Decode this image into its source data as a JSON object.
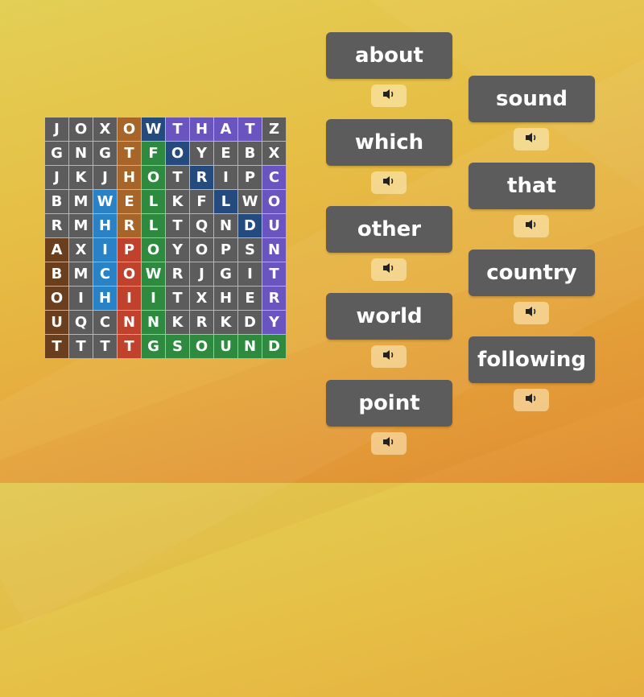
{
  "colors": {
    "cell_default": "#5c5c5c",
    "word_button": "#5c5c5c",
    "highlight": {
      "other": "#a8652a",
      "world": "#254a7d",
      "that": "#6a54c0",
      "following": "#2e8a3e",
      "country": "#6a54c0",
      "which": "#2a82c6",
      "about": "#6b3e1e",
      "point": "#c0412c",
      "sound": "#2e8a3e"
    }
  },
  "grid": {
    "rows": [
      [
        "J",
        "O",
        "X",
        "O",
        "W",
        "T",
        "H",
        "A",
        "T",
        "Z"
      ],
      [
        "G",
        "N",
        "G",
        "T",
        "F",
        "O",
        "Y",
        "E",
        "B",
        "X"
      ],
      [
        "J",
        "K",
        "J",
        "H",
        "O",
        "T",
        "R",
        "I",
        "P",
        "C"
      ],
      [
        "B",
        "M",
        "W",
        "E",
        "L",
        "K",
        "F",
        "L",
        "W",
        "O"
      ],
      [
        "R",
        "M",
        "H",
        "R",
        "L",
        "T",
        "Q",
        "N",
        "D",
        "U"
      ],
      [
        "A",
        "X",
        "I",
        "P",
        "O",
        "Y",
        "O",
        "P",
        "S",
        "N"
      ],
      [
        "B",
        "M",
        "C",
        "O",
        "W",
        "R",
        "J",
        "G",
        "I",
        "T"
      ],
      [
        "O",
        "I",
        "H",
        "I",
        "I",
        "T",
        "X",
        "H",
        "E",
        "R"
      ],
      [
        "U",
        "Q",
        "C",
        "N",
        "N",
        "K",
        "R",
        "K",
        "D",
        "Y"
      ],
      [
        "T",
        "T",
        "T",
        "T",
        "G",
        "S",
        "O",
        "U",
        "N",
        "D"
      ]
    ],
    "found_words": [
      {
        "word": "other",
        "cells": [
          [
            0,
            3
          ],
          [
            1,
            3
          ],
          [
            2,
            3
          ],
          [
            3,
            3
          ],
          [
            4,
            3
          ]
        ]
      },
      {
        "word": "world",
        "cells": [
          [
            0,
            4
          ],
          [
            1,
            5
          ],
          [
            2,
            6
          ],
          [
            3,
            7
          ],
          [
            4,
            8
          ]
        ]
      },
      {
        "word": "that",
        "cells": [
          [
            0,
            5
          ],
          [
            0,
            6
          ],
          [
            0,
            7
          ],
          [
            0,
            8
          ]
        ]
      },
      {
        "word": "following",
        "cells": [
          [
            1,
            4
          ],
          [
            2,
            4
          ],
          [
            3,
            4
          ],
          [
            4,
            4
          ],
          [
            5,
            4
          ],
          [
            6,
            4
          ],
          [
            7,
            4
          ],
          [
            8,
            4
          ],
          [
            9,
            4
          ]
        ]
      },
      {
        "word": "country",
        "cells": [
          [
            2,
            9
          ],
          [
            3,
            9
          ],
          [
            4,
            9
          ],
          [
            5,
            9
          ],
          [
            6,
            9
          ],
          [
            7,
            9
          ],
          [
            8,
            9
          ]
        ]
      },
      {
        "word": "which",
        "cells": [
          [
            3,
            2
          ],
          [
            4,
            2
          ],
          [
            5,
            2
          ],
          [
            6,
            2
          ],
          [
            7,
            2
          ]
        ]
      },
      {
        "word": "about",
        "cells": [
          [
            5,
            0
          ],
          [
            6,
            0
          ],
          [
            7,
            0
          ],
          [
            8,
            0
          ],
          [
            9,
            0
          ]
        ]
      },
      {
        "word": "point",
        "cells": [
          [
            5,
            3
          ],
          [
            6,
            3
          ],
          [
            7,
            3
          ],
          [
            8,
            3
          ],
          [
            9,
            3
          ]
        ]
      },
      {
        "word": "sound",
        "cells": [
          [
            9,
            5
          ],
          [
            9,
            6
          ],
          [
            9,
            7
          ],
          [
            9,
            8
          ],
          [
            9,
            9
          ]
        ]
      }
    ]
  },
  "words": {
    "left": [
      "about",
      "which",
      "other",
      "world",
      "point"
    ],
    "right": [
      "sound",
      "that",
      "country",
      "following"
    ]
  },
  "icons": {
    "audio": "speaker-icon"
  }
}
